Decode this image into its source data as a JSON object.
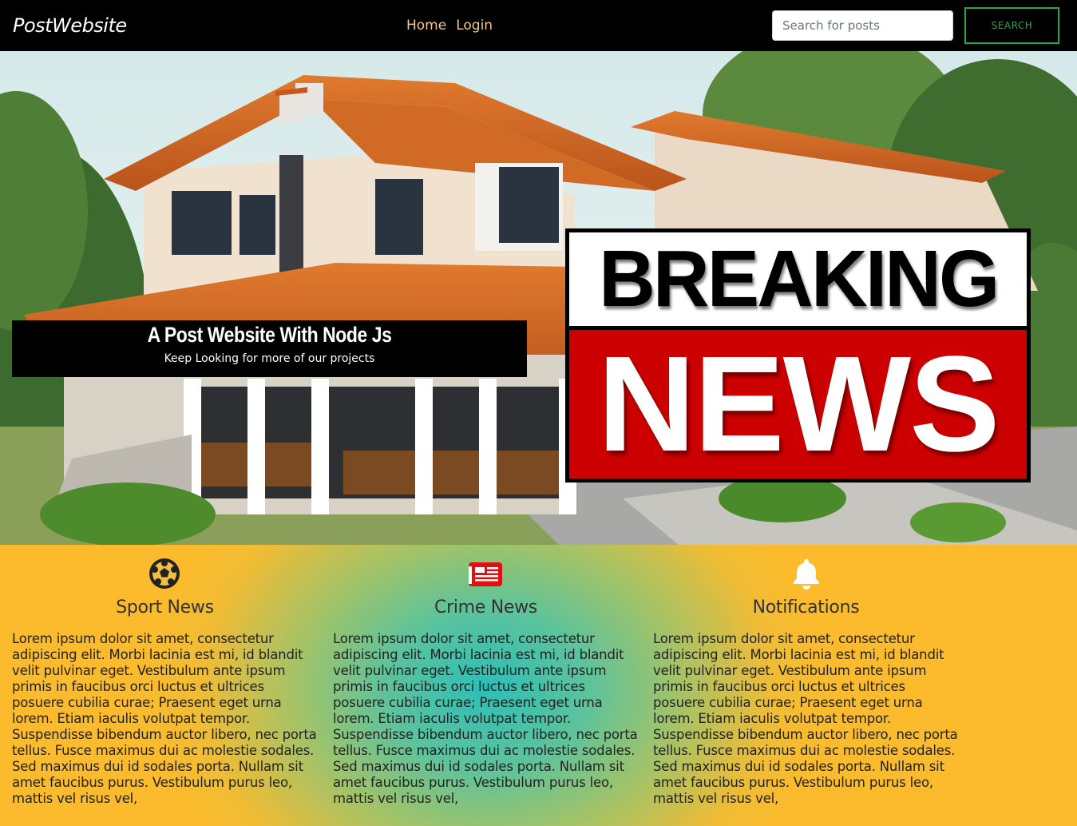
{
  "navbar": {
    "brand": "PostWebsite",
    "links": [
      "Home",
      "Login"
    ],
    "search_placeholder": "Search for posts",
    "search_button": "SEARCH"
  },
  "hero": {
    "caption_title": "A Post Website With Node Js",
    "caption_subtitle": "Keep Looking for more of our projects",
    "banner_top": "BREAKING",
    "banner_bottom": "NEWS"
  },
  "features": [
    {
      "icon": "soccer-ball-icon",
      "title": "Sport News",
      "text": "Lorem ipsum dolor sit amet, consectetur adipiscing elit. Morbi lacinia est mi, id blandit velit pulvinar eget. Vestibulum ante ipsum primis in faucibus orci luctus et ultrices posuere cubilia curae; Praesent eget urna lorem. Etiam iaculis volutpat tempor. Suspendisse bibendum auctor libero, nec porta tellus. Fusce maximus dui ac molestie sodales. Sed maximus dui id sodales porta. Nullam sit amet faucibus purus. Vestibulum purus leo, mattis vel risus vel,"
    },
    {
      "icon": "newspaper-icon",
      "title": "Crime News",
      "text": "Lorem ipsum dolor sit amet, consectetur adipiscing elit. Morbi lacinia est mi, id blandit velit pulvinar eget. Vestibulum ante ipsum primis in faucibus orci luctus et ultrices posuere cubilia curae; Praesent eget urna lorem. Etiam iaculis volutpat tempor. Suspendisse bibendum auctor libero, nec porta tellus. Fusce maximus dui ac molestie sodales. Sed maximus dui id sodales porta. Nullam sit amet faucibus purus. Vestibulum purus leo, mattis vel risus vel,"
    },
    {
      "icon": "bell-icon",
      "title": "Notifications",
      "text": "Lorem ipsum dolor sit amet, consectetur adipiscing elit. Morbi lacinia est mi, id blandit velit pulvinar eget. Vestibulum ante ipsum primis in faucibus orci luctus et ultrices posuere cubilia curae; Praesent eget urna lorem. Etiam iaculis volutpat tempor. Suspendisse bibendum auctor libero, nec porta tellus. Fusce maximus dui ac molestie sodales. Sed maximus dui id sodales porta. Nullam sit amet faucibus purus. Vestibulum purus leo, mattis vel risus vel,"
    }
  ],
  "colors": {
    "nav_link": "#f3c98b",
    "search_button": "#28a745",
    "banner_red": "#cc0000",
    "newspaper_icon": "#e01010",
    "gradient_center": "#2bbfb8",
    "gradient_edge": "#fbbb2c"
  }
}
